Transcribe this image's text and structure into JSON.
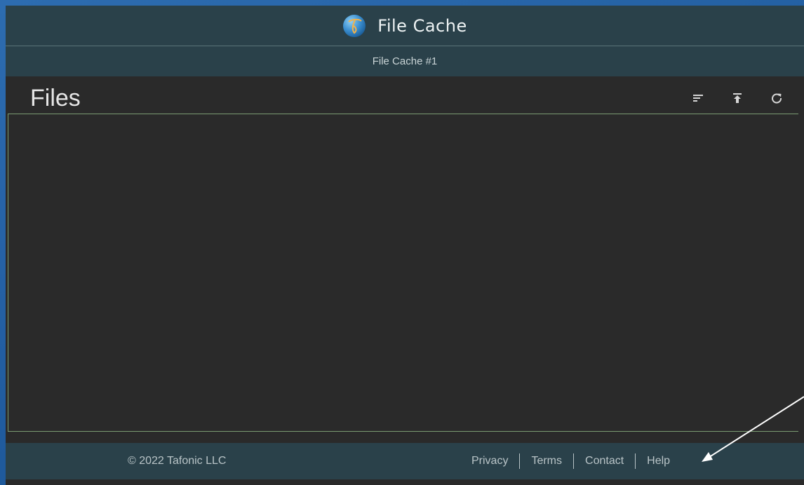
{
  "header": {
    "title": "File Cache",
    "subtitle": "File Cache #1",
    "logo_icon": "tafonic-logo"
  },
  "files": {
    "title": "Files",
    "toolbar": [
      {
        "icon": "sort-icon"
      },
      {
        "icon": "upload-icon"
      },
      {
        "icon": "refresh-icon"
      }
    ]
  },
  "footer": {
    "copyright": "© 2022 Tafonic LLC",
    "links": {
      "privacy": "Privacy",
      "terms": "Terms",
      "contact": "Contact",
      "help": "Help"
    }
  },
  "colors": {
    "header_bg": "#2a414a",
    "content_bg": "#2a2a2a",
    "pane_border": "#7a9c72",
    "page_bg": "#2d6cb0"
  }
}
